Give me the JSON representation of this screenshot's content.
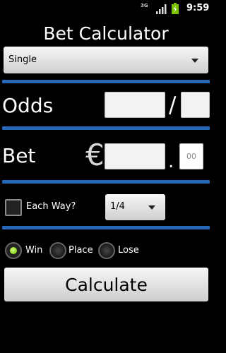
{
  "status_bar": {
    "network": "3G",
    "time": "9:59"
  },
  "title": "Bet Calculator",
  "bet_type": {
    "selected": "Single"
  },
  "odds": {
    "label": "Odds",
    "separator": "/",
    "numerator": "",
    "denominator": ""
  },
  "bet": {
    "label": "Bet",
    "currency_symbol": "€",
    "decimal_separator": ".",
    "amount": "",
    "cents_placeholder": "00"
  },
  "each_way": {
    "label": "Each Way?",
    "checked": false,
    "fraction": "1/4"
  },
  "result": {
    "options": [
      "Win",
      "Place",
      "Lose"
    ],
    "selected": "Win"
  },
  "calculate_label": "Calculate",
  "colors": {
    "accent": "#2568b8",
    "radio_selected": "#8fe000",
    "background": "#000000"
  }
}
